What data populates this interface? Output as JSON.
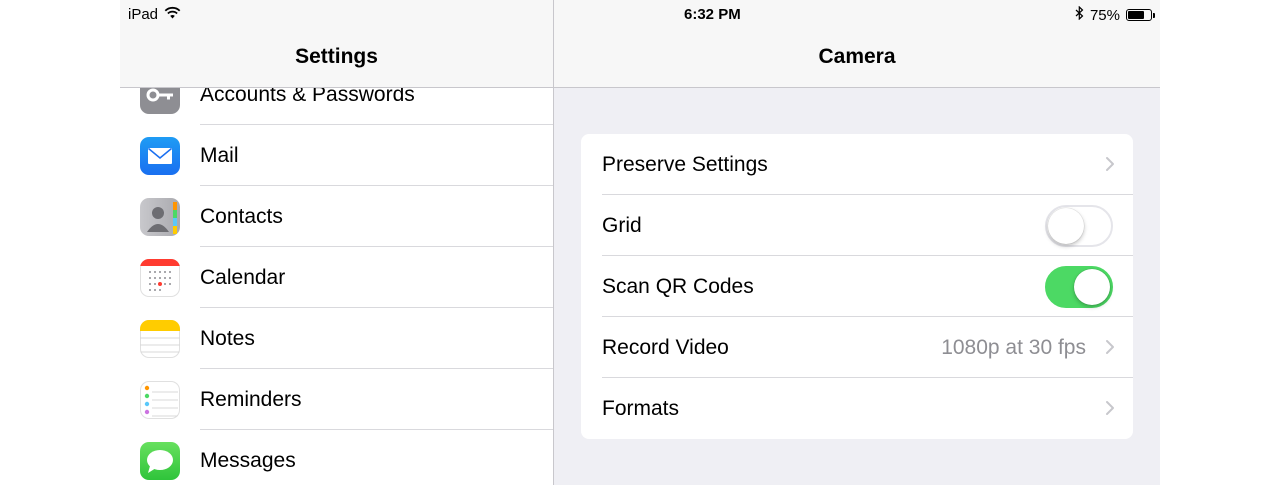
{
  "status_bar": {
    "device": "iPad",
    "time": "6:32 PM",
    "battery_text": "75%",
    "battery_level": 0.75,
    "icons": [
      "wifi-icon",
      "bluetooth-icon",
      "battery-icon"
    ]
  },
  "master": {
    "title": "Settings",
    "items": [
      {
        "label": "Accounts & Passwords",
        "icon": "key-icon"
      },
      {
        "label": "Mail",
        "icon": "mail-icon"
      },
      {
        "label": "Contacts",
        "icon": "contacts-icon"
      },
      {
        "label": "Calendar",
        "icon": "calendar-icon"
      },
      {
        "label": "Notes",
        "icon": "notes-icon"
      },
      {
        "label": "Reminders",
        "icon": "reminders-icon"
      },
      {
        "label": "Messages",
        "icon": "messages-icon"
      }
    ]
  },
  "detail": {
    "title": "Camera",
    "rows": [
      {
        "label": "Preserve Settings",
        "accessory": "chevron"
      },
      {
        "label": "Grid",
        "accessory": "toggle",
        "on": false
      },
      {
        "label": "Scan QR Codes",
        "accessory": "toggle",
        "on": true
      },
      {
        "label": "Record Video",
        "accessory": "chevron",
        "value": "1080p at 30 fps"
      },
      {
        "label": "Formats",
        "accessory": "chevron"
      }
    ]
  },
  "colors": {
    "toggle_on": "#4cd964",
    "group_bg": "#efeff4",
    "secondary_text": "#8e8e93"
  }
}
